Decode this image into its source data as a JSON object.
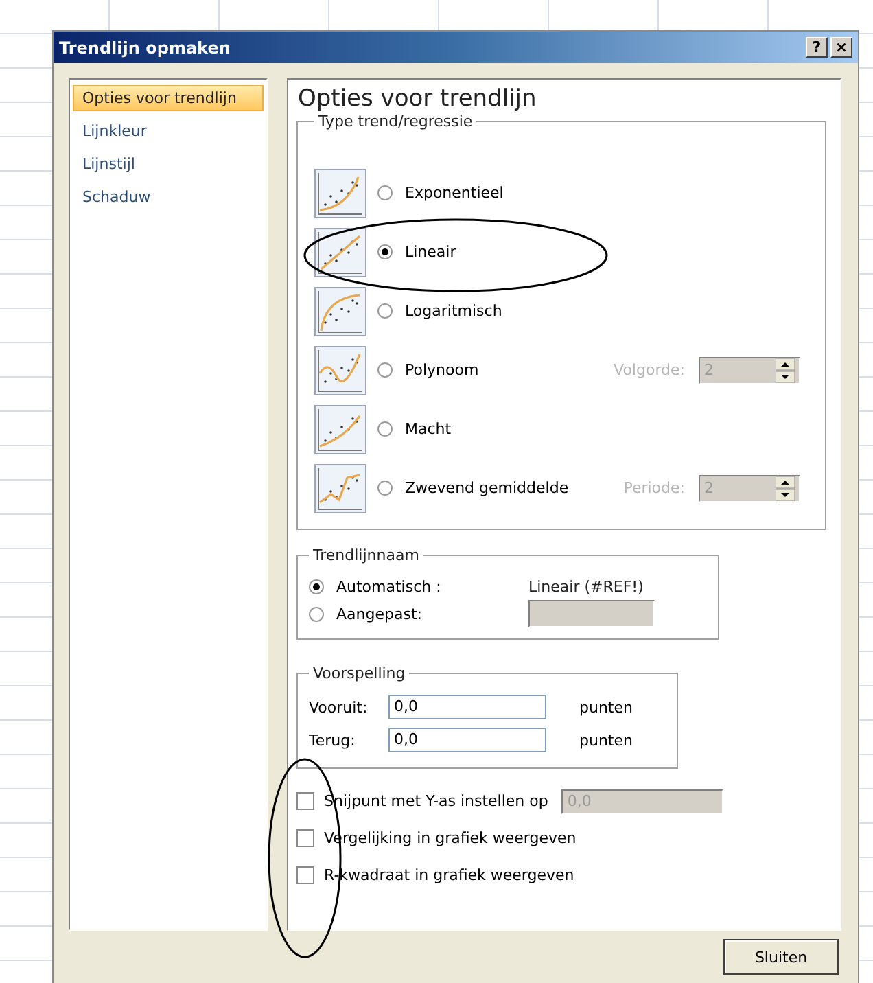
{
  "window": {
    "title": "Trendlijn opmaken",
    "help_button": "?",
    "close_button": "×"
  },
  "sidebar": {
    "items": [
      {
        "label": "Opties voor trendlijn",
        "selected": true
      },
      {
        "label": "Lijnkleur",
        "selected": false
      },
      {
        "label": "Lijnstijl",
        "selected": false
      },
      {
        "label": "Schaduw",
        "selected": false
      }
    ]
  },
  "heading": "Opties voor trendlijn",
  "trend_type": {
    "legend": "Type trend/regressie",
    "options": [
      {
        "kind": "exponential",
        "label": "Exponentieel",
        "selected": false
      },
      {
        "kind": "linear",
        "label": "Lineair",
        "selected": true
      },
      {
        "kind": "logarithmic",
        "label": "Logaritmisch",
        "selected": false
      },
      {
        "kind": "polynomial",
        "label": "Polynoom",
        "selected": false,
        "spinner": {
          "label": "Volgorde:",
          "value": "2",
          "disabled": true
        }
      },
      {
        "kind": "power",
        "label": "Macht",
        "selected": false
      },
      {
        "kind": "moving_average",
        "label": "Zwevend gemiddelde",
        "selected": false,
        "spinner": {
          "label": "Periode:",
          "value": "2",
          "disabled": true
        }
      }
    ]
  },
  "trendline_name": {
    "legend": "Trendlijnnaam",
    "options": [
      {
        "label": "Automatisch :",
        "selected": true,
        "value": "Lineair (#REF!)"
      },
      {
        "label": "Aangepast:",
        "selected": false,
        "field_disabled": true
      }
    ]
  },
  "forecast": {
    "legend": "Voorspelling",
    "fields": [
      {
        "label": "Vooruit:",
        "value": "0,0",
        "unit": "punten"
      },
      {
        "label": "Terug:",
        "value": "0,0",
        "unit": "punten"
      }
    ]
  },
  "checkboxes": [
    {
      "label": "Snijpunt met Y-as instellen op",
      "checked": false,
      "field": {
        "value": "0,0",
        "disabled": true
      }
    },
    {
      "label": "Vergelijking in grafiek weergeven",
      "checked": false
    },
    {
      "label": "R-kwadraat in grafiek weergeven",
      "checked": false
    }
  ],
  "buttons": [
    "Sluiten"
  ]
}
